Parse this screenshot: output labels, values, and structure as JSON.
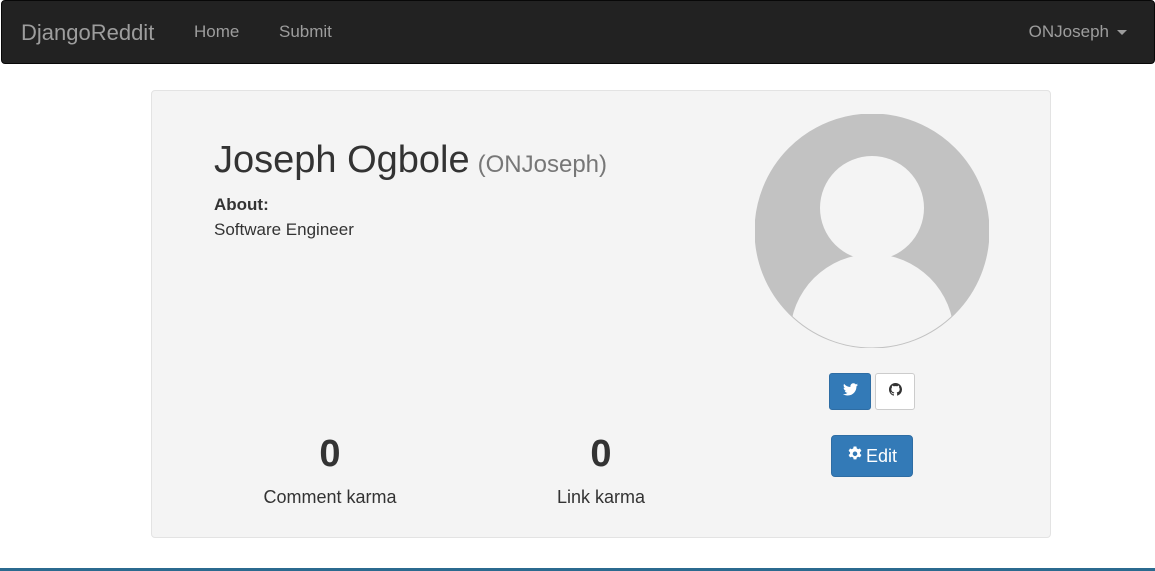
{
  "navbar": {
    "brand": "DjangoReddit",
    "links": [
      "Home",
      "Submit"
    ],
    "user": "ONJoseph"
  },
  "profile": {
    "full_name": "Joseph Ogbole",
    "username": "(ONJoseph)",
    "about_label": "About:",
    "about_text": "Software Engineer",
    "edit_label": "Edit",
    "avatar_icon": "default-avatar-icon",
    "social": [
      "twitter-icon",
      "github-icon"
    ]
  },
  "karma": {
    "comment": {
      "value": "0",
      "label": "Comment karma"
    },
    "link": {
      "value": "0",
      "label": "Link karma"
    }
  },
  "colors": {
    "navbar": "#222222",
    "primary": "#337ab7",
    "card": "#f4f4f4"
  }
}
